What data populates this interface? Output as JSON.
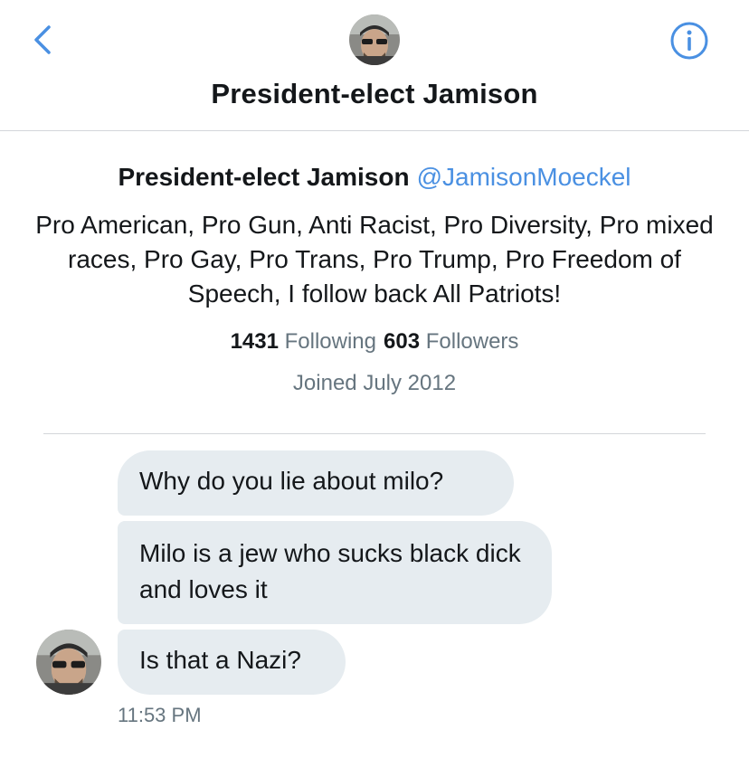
{
  "header": {
    "title": "President-elect Jamison",
    "back_icon": "chevron-left-icon",
    "info_icon": "info-icon",
    "accent_color": "#4a90e2"
  },
  "profile": {
    "name": "President-elect Jamison",
    "handle": "@JamisonMoeckel",
    "bio": "Pro American, Pro Gun, Anti Racist, Pro Diversity, Pro mixed races, Pro Gay, Pro Trans, Pro Trump, Pro Freedom of Speech, I follow back All Patriots!",
    "following_count": "1431",
    "following_label": "Following",
    "followers_count": "603",
    "followers_label": "Followers",
    "joined": "Joined July 2012"
  },
  "messages": [
    {
      "text": "Why do you lie about milo?"
    },
    {
      "text": "Milo is a jew who sucks black dick and loves it"
    },
    {
      "text": "Is that a Nazi?"
    }
  ],
  "timestamp": "11:53 PM",
  "colors": {
    "bubble_bg": "#e6ecf0",
    "secondary_text": "#66757f",
    "link": "#4a90e2"
  }
}
